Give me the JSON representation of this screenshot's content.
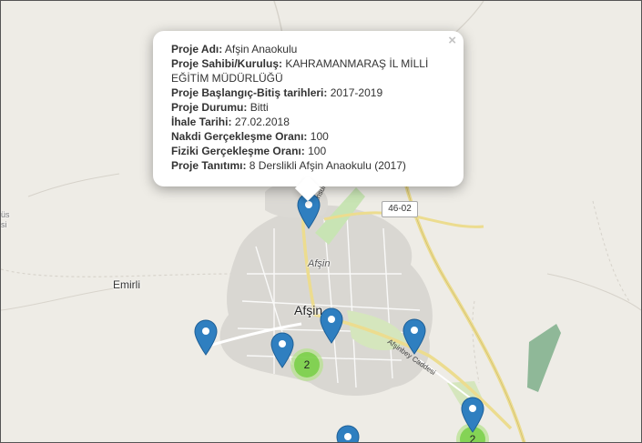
{
  "map": {
    "labels": {
      "emirli": "Emirli",
      "afsin_town": "Afşin",
      "afsin_district": "Afşin",
      "edge_left": "üs\nsi",
      "road_badge": "46-02",
      "street_ask": "Aşık Mansuri Şerif Bl.",
      "street_caddesi": "Afşinbey Caddesi"
    },
    "colors": {
      "background": "#eeece6",
      "major_road": "#ecdc8f",
      "urban": "#d9d7d2",
      "green_area": "#c8e4b4",
      "marker": "#2f7fc0"
    }
  },
  "markers": [
    {
      "name": "marker-afsin-anaokulu",
      "icon": "map-pin-icon"
    },
    {
      "name": "marker-west",
      "icon": "map-pin-icon"
    },
    {
      "name": "marker-south",
      "icon": "map-pin-icon"
    },
    {
      "name": "marker-center",
      "icon": "map-pin-icon"
    },
    {
      "name": "marker-east",
      "icon": "map-pin-icon"
    },
    {
      "name": "marker-southeast",
      "icon": "map-pin-icon"
    },
    {
      "name": "marker-bottom",
      "icon": "map-pin-icon"
    }
  ],
  "clusters": [
    {
      "name": "cluster-south",
      "count": "2"
    },
    {
      "name": "cluster-southeast",
      "count": "2"
    }
  ],
  "popup": {
    "close_symbol": "×",
    "rows": [
      {
        "label": "Proje Adı:",
        "value": "Afşin Anaokulu"
      },
      {
        "label": "Proje Sahibi/Kuruluş:",
        "value": "KAHRAMANMARAŞ İL MİLLİ EĞİTİM MÜDÜRLÜĞÜ"
      },
      {
        "label": "Proje Başlangıç-Bitiş tarihleri:",
        "value": "2017-2019"
      },
      {
        "label": "Proje Durumu:",
        "value": "Bitti"
      },
      {
        "label": "İhale Tarihi:",
        "value": "27.02.2018"
      },
      {
        "label": "Nakdi Gerçekleşme Oranı:",
        "value": "100"
      },
      {
        "label": "Fiziki Gerçekleşme Oranı:",
        "value": "100"
      },
      {
        "label": "Proje Tanıtımı:",
        "value": "8 Derslikli Afşin Anaokulu (2017)"
      }
    ]
  }
}
